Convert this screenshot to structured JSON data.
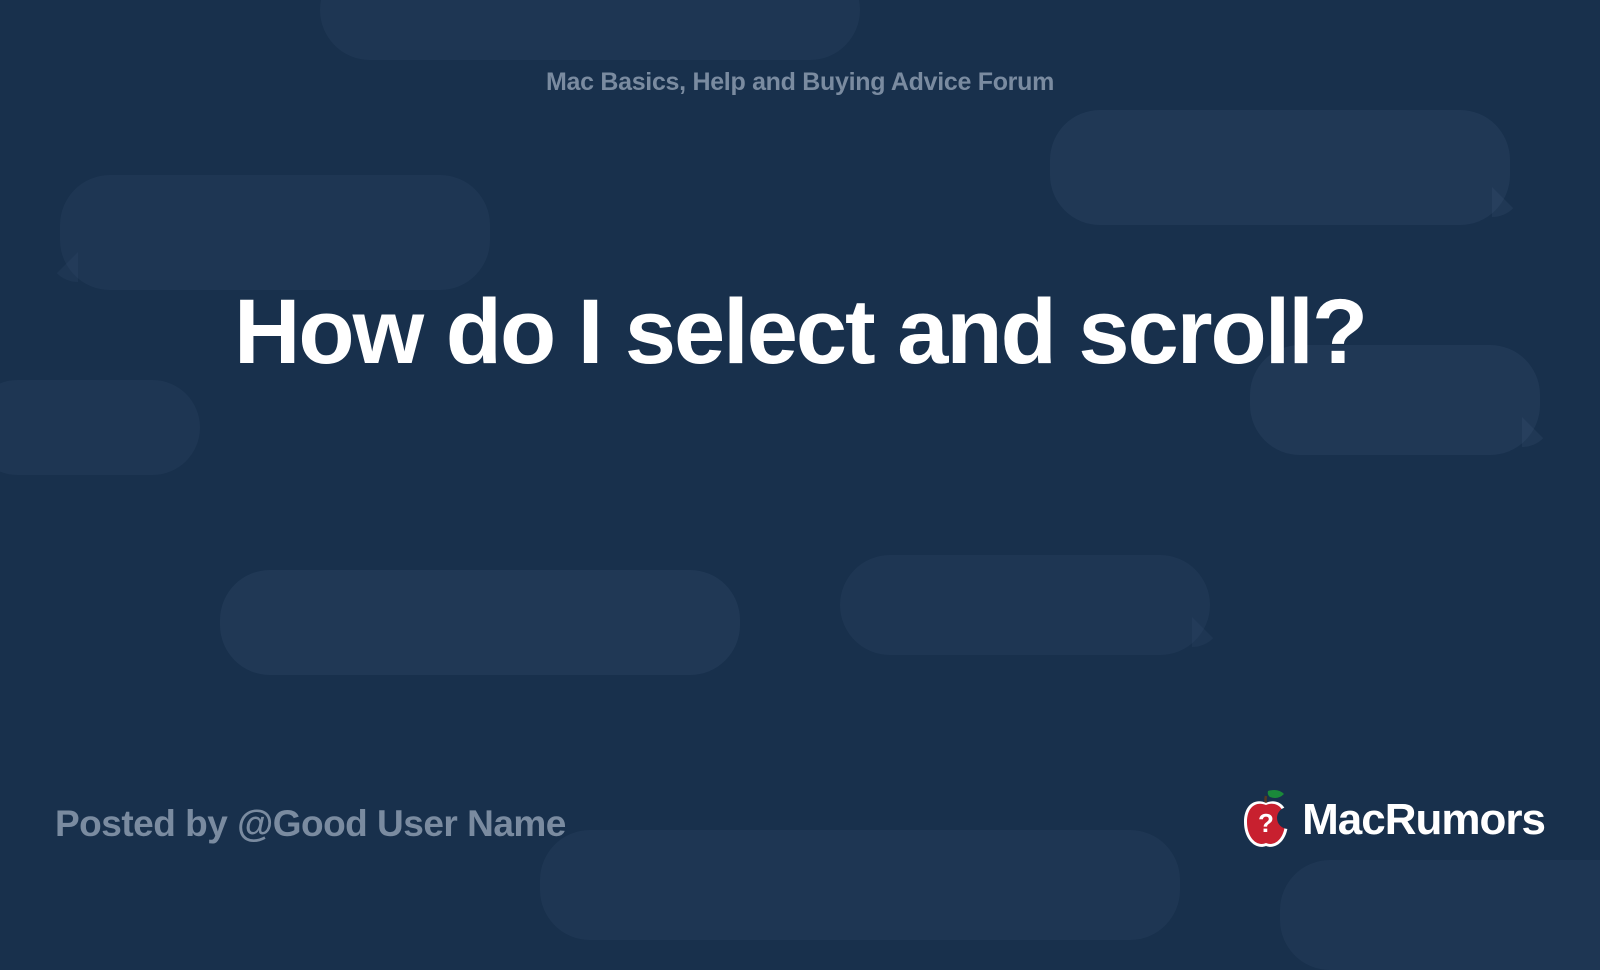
{
  "forum_name": "Mac Basics, Help and Buying Advice Forum",
  "thread_title": "How do I select and scroll?",
  "posted_by_prefix": "Posted by @",
  "author": "Good User Name",
  "brand_name": "MacRumors",
  "colors": {
    "background": "#18304c",
    "text_muted": "#7a8ba0",
    "text_primary": "#ffffff",
    "logo_red": "#c8202f",
    "logo_green": "#1a8a3a"
  }
}
